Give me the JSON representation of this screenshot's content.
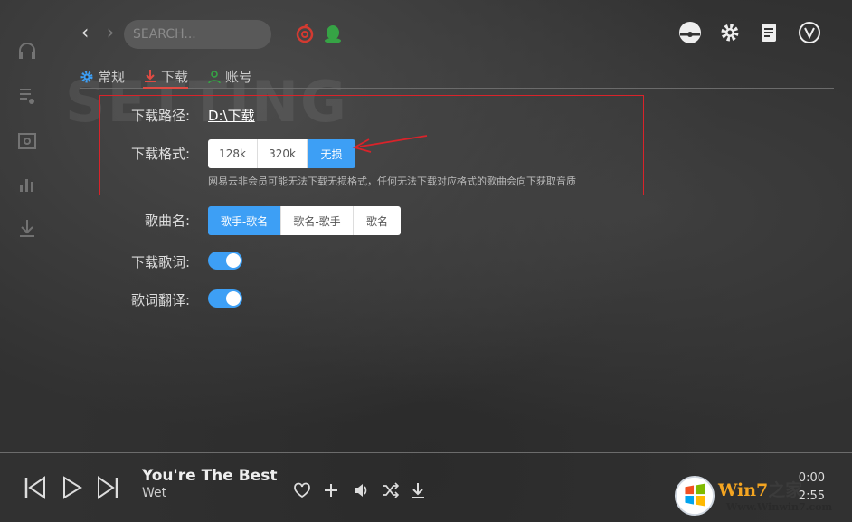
{
  "search": {
    "placeholder": "SEARCH..."
  },
  "watermark": "SETTING",
  "tabs": [
    {
      "label": "常规",
      "icon": "gear-icon",
      "active": false
    },
    {
      "label": "下载",
      "icon": "download-icon",
      "active": true
    },
    {
      "label": "账号",
      "icon": "user-icon",
      "active": false
    }
  ],
  "settings": {
    "path_label": "下载路径:",
    "path_value": "D:\\下载",
    "format_label": "下载格式:",
    "format_options": [
      "128k",
      "320k",
      "无损"
    ],
    "format_selected": "无损",
    "format_hint": "网易云非会员可能无法下载无损格式，任何无法下载对应格式的歌曲会向下获取音质",
    "name_label": "歌曲名:",
    "name_options": [
      "歌手-歌名",
      "歌名-歌手",
      "歌名"
    ],
    "name_selected": "歌手-歌名",
    "lyrics_label": "下载歌词:",
    "lyrics_on": true,
    "translate_label": "歌词翻译:",
    "translate_on": true
  },
  "player": {
    "title": "You're The Best",
    "artist": "Wet",
    "current_time": "0:00",
    "duration": "2:55"
  },
  "badge": {
    "brand": "Win7",
    "suffix": "之家",
    "url": "Www.Winwin7.com"
  },
  "colors": {
    "accent": "#3d9ff5",
    "highlight": "#d9232a",
    "active_tab": "#e04b43"
  }
}
